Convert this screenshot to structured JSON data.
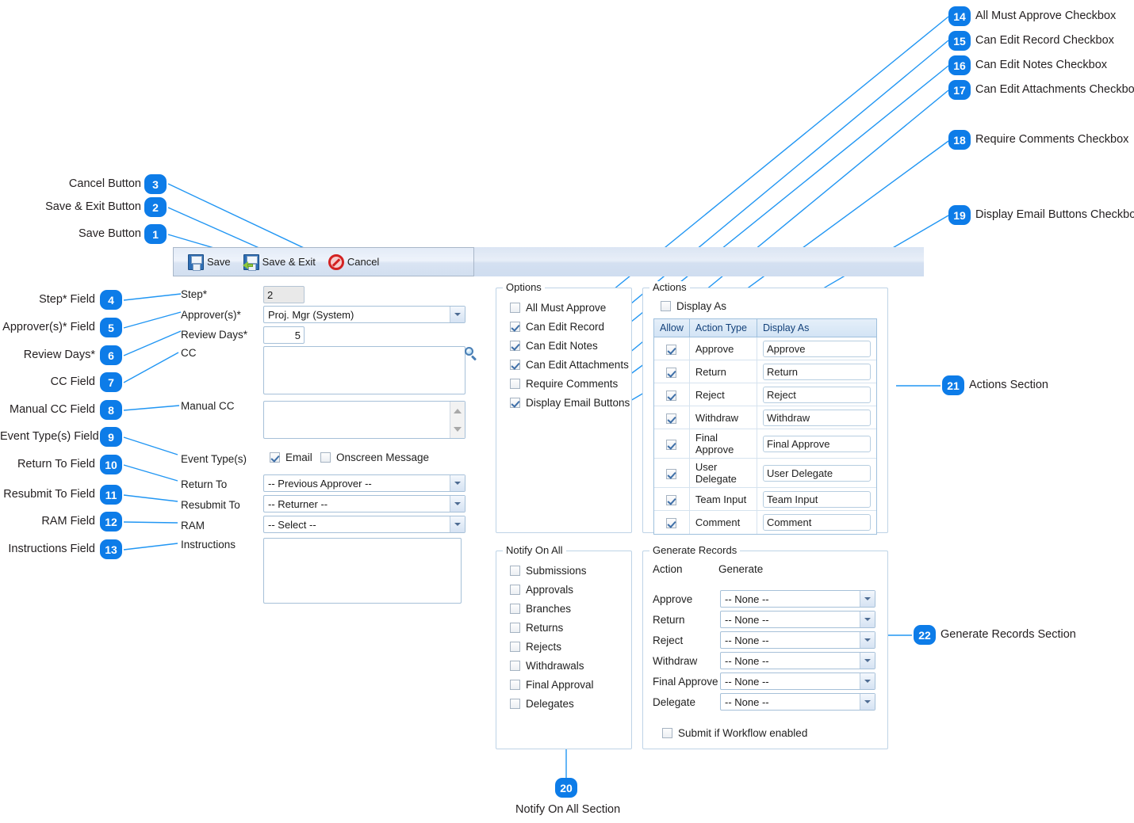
{
  "toolbar": {
    "buttons": [
      {
        "label": "Save",
        "icon": "floppy-disk-icon"
      },
      {
        "label": "Save & Exit",
        "icon": "floppy-disk-exit-icon"
      },
      {
        "label": "Cancel",
        "icon": "cancel-circle-icon"
      }
    ]
  },
  "form": {
    "step": {
      "label": "Step*",
      "value": "2"
    },
    "approvers": {
      "label": "Approver(s)*",
      "value": "Proj. Mgr (System)"
    },
    "review_days": {
      "label": "Review Days*",
      "value": "5"
    },
    "cc": {
      "label": "CC",
      "value": "",
      "search_icon": "search-icon"
    },
    "manual_cc": {
      "label": "Manual CC",
      "value": ""
    },
    "event_types": {
      "label": "Event Type(s)",
      "options": [
        {
          "label": "Email",
          "checked": true
        },
        {
          "label": "Onscreen Message",
          "checked": false
        }
      ]
    },
    "return_to": {
      "label": "Return To",
      "value": "-- Previous Approver --"
    },
    "resubmit_to": {
      "label": "Resubmit To",
      "value": "-- Returner --"
    },
    "ram": {
      "label": "RAM",
      "value": "-- Select --"
    },
    "instructions": {
      "label": "Instructions",
      "value": ""
    }
  },
  "options": {
    "title": "Options",
    "items": [
      {
        "label": "All Must Approve",
        "checked": false
      },
      {
        "label": "Can Edit Record",
        "checked": true
      },
      {
        "label": "Can Edit Notes",
        "checked": true
      },
      {
        "label": "Can Edit Attachments",
        "checked": true
      },
      {
        "label": "Require Comments",
        "checked": false
      },
      {
        "label": "Display Email Buttons",
        "checked": true
      }
    ]
  },
  "actions": {
    "title": "Actions",
    "display_as_checkbox": {
      "label": "Display As",
      "checked": false
    },
    "columns": [
      "Allow",
      "Action Type",
      "Display As"
    ],
    "rows": [
      {
        "allow": true,
        "type": "Approve",
        "display_as": "Approve"
      },
      {
        "allow": true,
        "type": "Return",
        "display_as": "Return"
      },
      {
        "allow": true,
        "type": "Reject",
        "display_as": "Reject"
      },
      {
        "allow": true,
        "type": "Withdraw",
        "display_as": "Withdraw"
      },
      {
        "allow": true,
        "type": "Final Approve",
        "display_as": "Final Approve"
      },
      {
        "allow": true,
        "type": "User Delegate",
        "display_as": "User Delegate"
      },
      {
        "allow": true,
        "type": "Team Input",
        "display_as": "Team Input"
      },
      {
        "allow": true,
        "type": "Comment",
        "display_as": "Comment"
      }
    ]
  },
  "notify_on_all": {
    "title": "Notify On All",
    "items": [
      {
        "label": "Submissions",
        "checked": false
      },
      {
        "label": "Approvals",
        "checked": false
      },
      {
        "label": "Branches",
        "checked": false
      },
      {
        "label": "Returns",
        "checked": false
      },
      {
        "label": "Rejects",
        "checked": false
      },
      {
        "label": "Withdrawals",
        "checked": false
      },
      {
        "label": "Final Approval",
        "checked": false
      },
      {
        "label": "Delegates",
        "checked": false
      }
    ]
  },
  "generate_records": {
    "title": "Generate Records",
    "header_action": "Action",
    "header_generate": "Generate",
    "rows": [
      {
        "label": "Approve",
        "value": "-- None --"
      },
      {
        "label": "Return",
        "value": "-- None --"
      },
      {
        "label": "Reject",
        "value": "-- None --"
      },
      {
        "label": "Withdraw",
        "value": "-- None --"
      },
      {
        "label": "Final Approve",
        "value": "-- None --"
      },
      {
        "label": "Delegate",
        "value": "-- None --"
      }
    ],
    "submit_checkbox": {
      "label": "Submit if Workflow enabled",
      "checked": false
    }
  },
  "annotations": [
    {
      "num": "1",
      "text": "Save Button",
      "side": "left"
    },
    {
      "num": "2",
      "text": "Save & Exit Button",
      "side": "left"
    },
    {
      "num": "3",
      "text": "Cancel Button",
      "side": "left"
    },
    {
      "num": "4",
      "text": "Step* Field",
      "side": "left"
    },
    {
      "num": "5",
      "text": "Approver(s)* Field",
      "side": "left"
    },
    {
      "num": "6",
      "text": "Review Days*",
      "side": "left"
    },
    {
      "num": "7",
      "text": "CC Field",
      "side": "left"
    },
    {
      "num": "8",
      "text": "Manual CC Field",
      "side": "left"
    },
    {
      "num": "9",
      "text": "Event Type(s) Field",
      "side": "left"
    },
    {
      "num": "10",
      "text": "Return To Field",
      "side": "left"
    },
    {
      "num": "11",
      "text": "Resubmit To Field",
      "side": "left"
    },
    {
      "num": "12",
      "text": "RAM Field",
      "side": "left"
    },
    {
      "num": "13",
      "text": "Instructions Field",
      "side": "left"
    },
    {
      "num": "14",
      "text": "All Must Approve Checkbox",
      "side": "right"
    },
    {
      "num": "15",
      "text": "Can Edit Record Checkbox",
      "side": "right"
    },
    {
      "num": "16",
      "text": "Can Edit Notes Checkbox",
      "side": "right"
    },
    {
      "num": "17",
      "text": "Can Edit Attachments Checkbox",
      "side": "right"
    },
    {
      "num": "18",
      "text": "Require Comments Checkbox",
      "side": "right"
    },
    {
      "num": "19",
      "text": "Display Email Buttons Checkbox",
      "side": "right"
    },
    {
      "num": "20",
      "text": "Notify On All Section",
      "side": "bottom"
    },
    {
      "num": "21",
      "text": "Actions Section",
      "side": "right"
    },
    {
      "num": "22",
      "text": "Generate Records Section",
      "side": "right"
    }
  ],
  "colors": {
    "badge_blue": "#0d7ce8",
    "connector_blue": "#2196f3",
    "toolbar_blue": "#d8e3f2",
    "header_text_blue": "#13417a"
  }
}
